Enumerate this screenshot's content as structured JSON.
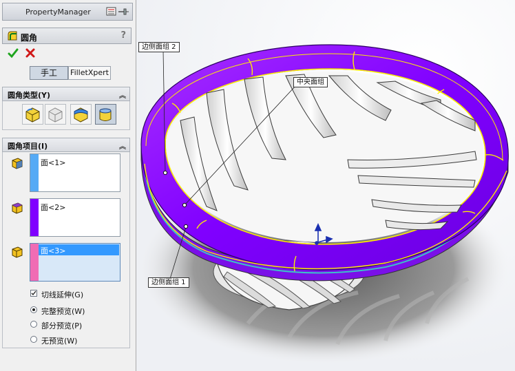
{
  "property_manager": {
    "title": "PropertyManager",
    "feature_title": "圆角",
    "help_label": "?",
    "tabs": [
      {
        "label": "手工",
        "active": true
      },
      {
        "label": "FilletXpert",
        "active": false
      }
    ]
  },
  "fillet_type_group": {
    "title": "圆角类型(Y)",
    "types": [
      "constant-radius-fillet-icon",
      "variable-radius-fillet-icon",
      "face-fillet-icon",
      "full-round-fillet-icon"
    ],
    "selected_index": 3
  },
  "fillet_items_group": {
    "title": "圆角项目(I)",
    "items": [
      {
        "label": "面<1>",
        "color": "#55aaf5"
      },
      {
        "label": "面<2>",
        "color": "#8000ff"
      },
      {
        "label": "面<3>",
        "color": "#f06cb4",
        "selected": true
      }
    ]
  },
  "options": {
    "tangent_propagation": {
      "label": "切线延伸(G)",
      "checked": true
    },
    "preview_modes": [
      {
        "label": "完整预览(W)",
        "selected": true
      },
      {
        "label": "部分预览(P)",
        "selected": false
      },
      {
        "label": "无预览(W)",
        "selected": false
      }
    ]
  },
  "viewport": {
    "callouts": {
      "side_face_set_2": "边侧面组 2",
      "center_face_set": "中央面组",
      "side_face_set_1": "边侧面组 1"
    },
    "colors": {
      "rim": "#8a00ff",
      "edge_highlight": "#ffee00",
      "fan_body": "#f4f4f4",
      "shadow": "#8c8c8c"
    }
  }
}
